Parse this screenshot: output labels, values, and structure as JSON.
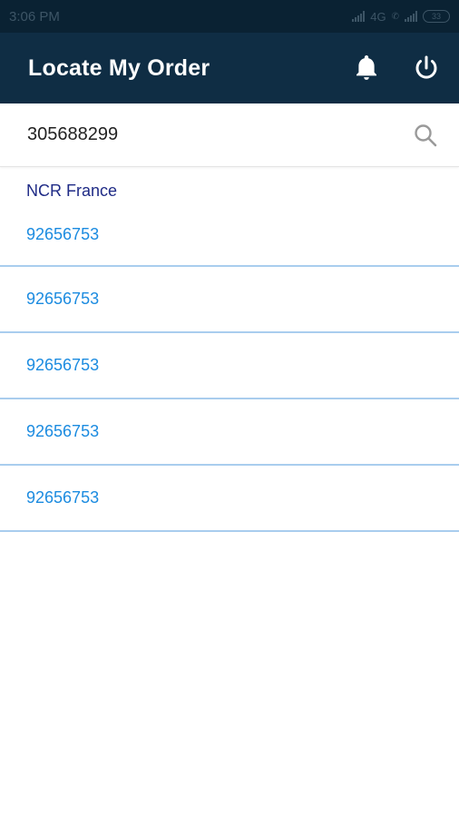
{
  "status_bar": {
    "time": "3:06 PM",
    "network": "4G",
    "battery": "33"
  },
  "app_bar": {
    "title": "Locate My Order",
    "icons": [
      "bell-icon",
      "power-icon"
    ]
  },
  "search": {
    "value": "305688299",
    "placeholder": ""
  },
  "group": {
    "name": "NCR France"
  },
  "orders": [
    {
      "number": "92656753"
    },
    {
      "number": "92656753"
    },
    {
      "number": "92656753"
    },
    {
      "number": "92656753"
    },
    {
      "number": "92656753"
    }
  ],
  "colors": {
    "app_bar": "#0f2d44",
    "status_bar": "#0a2233",
    "group_header_text": "#1f2b86",
    "order_link_text": "#1b8be0",
    "divider": "#a9cdee"
  }
}
